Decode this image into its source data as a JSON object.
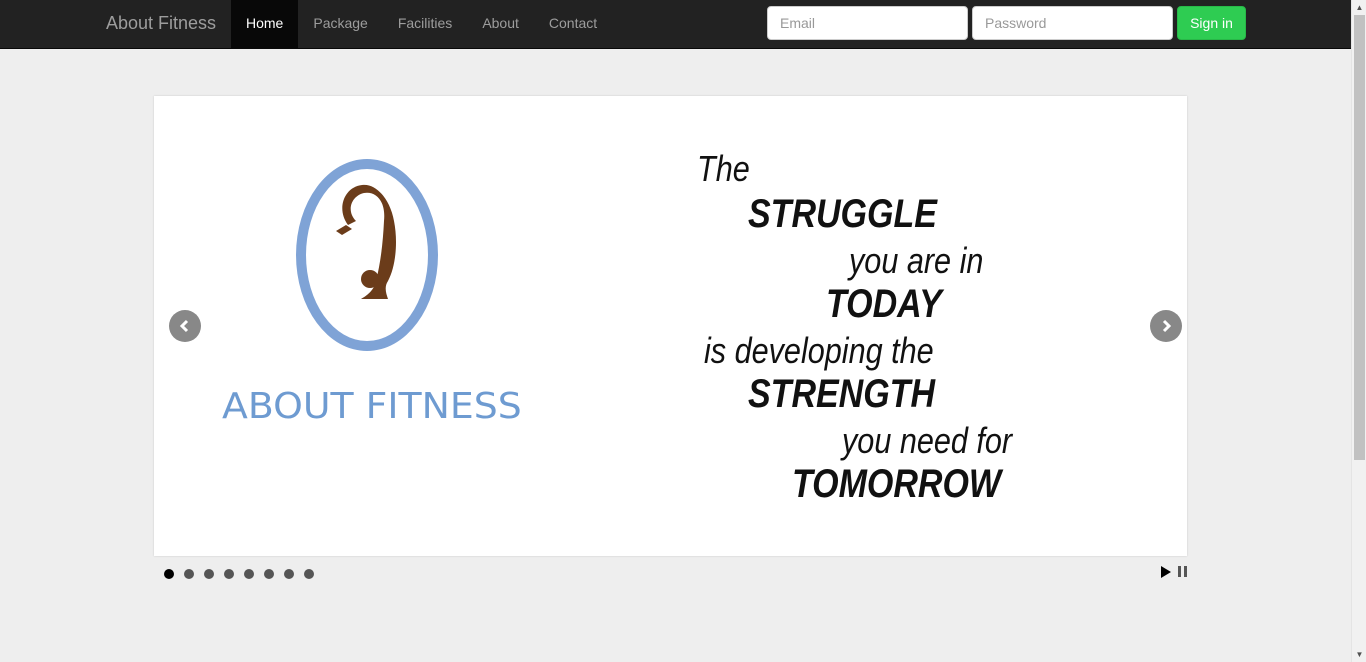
{
  "navbar": {
    "brand": "About Fitness",
    "links": [
      {
        "label": "Home",
        "active": true
      },
      {
        "label": "Package"
      },
      {
        "label": "Facilities"
      },
      {
        "label": "About"
      },
      {
        "label": "Contact"
      }
    ],
    "email_placeholder": "Email",
    "password_placeholder": "Password",
    "signin_label": "Sign in"
  },
  "slider": {
    "logo_text": "ABOUT FITNESS",
    "quote": {
      "line1": "The",
      "line2": "STRUGGLE",
      "line3": "you are in",
      "line4": "TODAY",
      "line5": "is developing the",
      "line6": "STRENGTH",
      "line7": "you need for",
      "line8": "TOMORROW"
    },
    "prev_icon": "chevron-left-icon",
    "next_icon": "chevron-right-icon",
    "slide_count": 8,
    "active_slide": 1
  },
  "colors": {
    "navbar_bg": "#222222",
    "signin_bg": "#2ecc52",
    "logo_blue": "#7fa3d6",
    "page_bg": "#eeeeee"
  }
}
